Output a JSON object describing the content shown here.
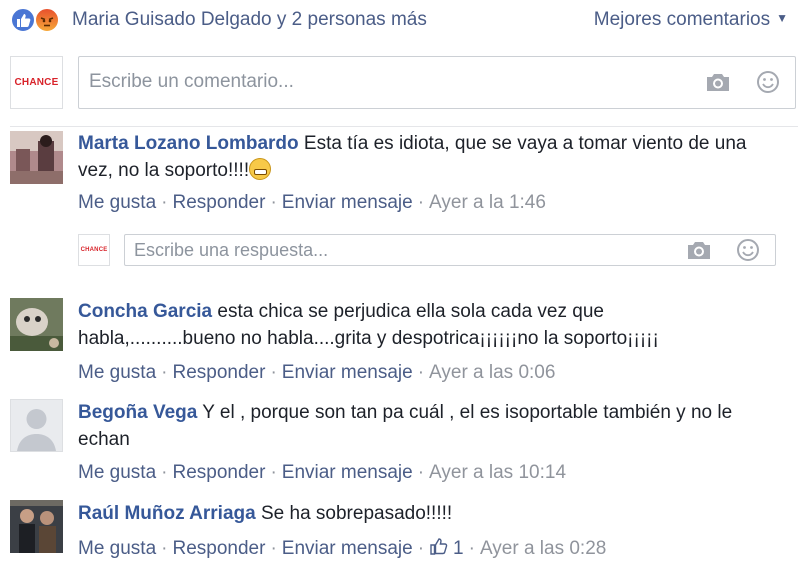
{
  "header": {
    "reactions": [
      "like-icon",
      "angry-icon"
    ],
    "likers": "Maria Guisado Delgado y 2 personas más",
    "sort": "Mejores comentarios"
  },
  "page_avatar_text": "CHANCE",
  "composer": {
    "placeholder": "Escribe un comentario..."
  },
  "comments": [
    {
      "author": "Marta Lozano Lombardo",
      "text": "Esta tía es idiota, que se vaya a tomar viento de una vez, no la soporto!!!!",
      "like": "Me gusta",
      "reply": "Responder",
      "message": "Enviar mensaje",
      "time": "Ayer a la 1:46",
      "reply_placeholder": "Escribe una respuesta..."
    },
    {
      "author": "Concha Garcia",
      "text": "esta chica se perjudica ella sola cada vez que habla,..........bueno no habla....grita y despotrica¡¡¡¡¡¡no la soporto¡¡¡¡¡",
      "like": "Me gusta",
      "reply": "Responder",
      "message": "Enviar mensaje",
      "time": "Ayer a las 0:06"
    },
    {
      "author": "Begoña Vega",
      "text": "Y el , porque son tan pa cuál , el es isoportable también y no le echan",
      "like": "Me gusta",
      "reply": "Responder",
      "message": "Enviar mensaje",
      "time": "Ayer a las 10:14"
    },
    {
      "author": "Raúl Muñoz Arriaga",
      "text": "Se ha sobrepasado!!!!!",
      "like": "Me gusta",
      "reply": "Responder",
      "message": "Enviar mensaje",
      "like_count": "1",
      "time": "Ayer a las 0:28"
    }
  ],
  "colors": {
    "link": "#4b5d87",
    "author": "#365899",
    "meta": "#90949c",
    "brand": "#d8232a"
  }
}
